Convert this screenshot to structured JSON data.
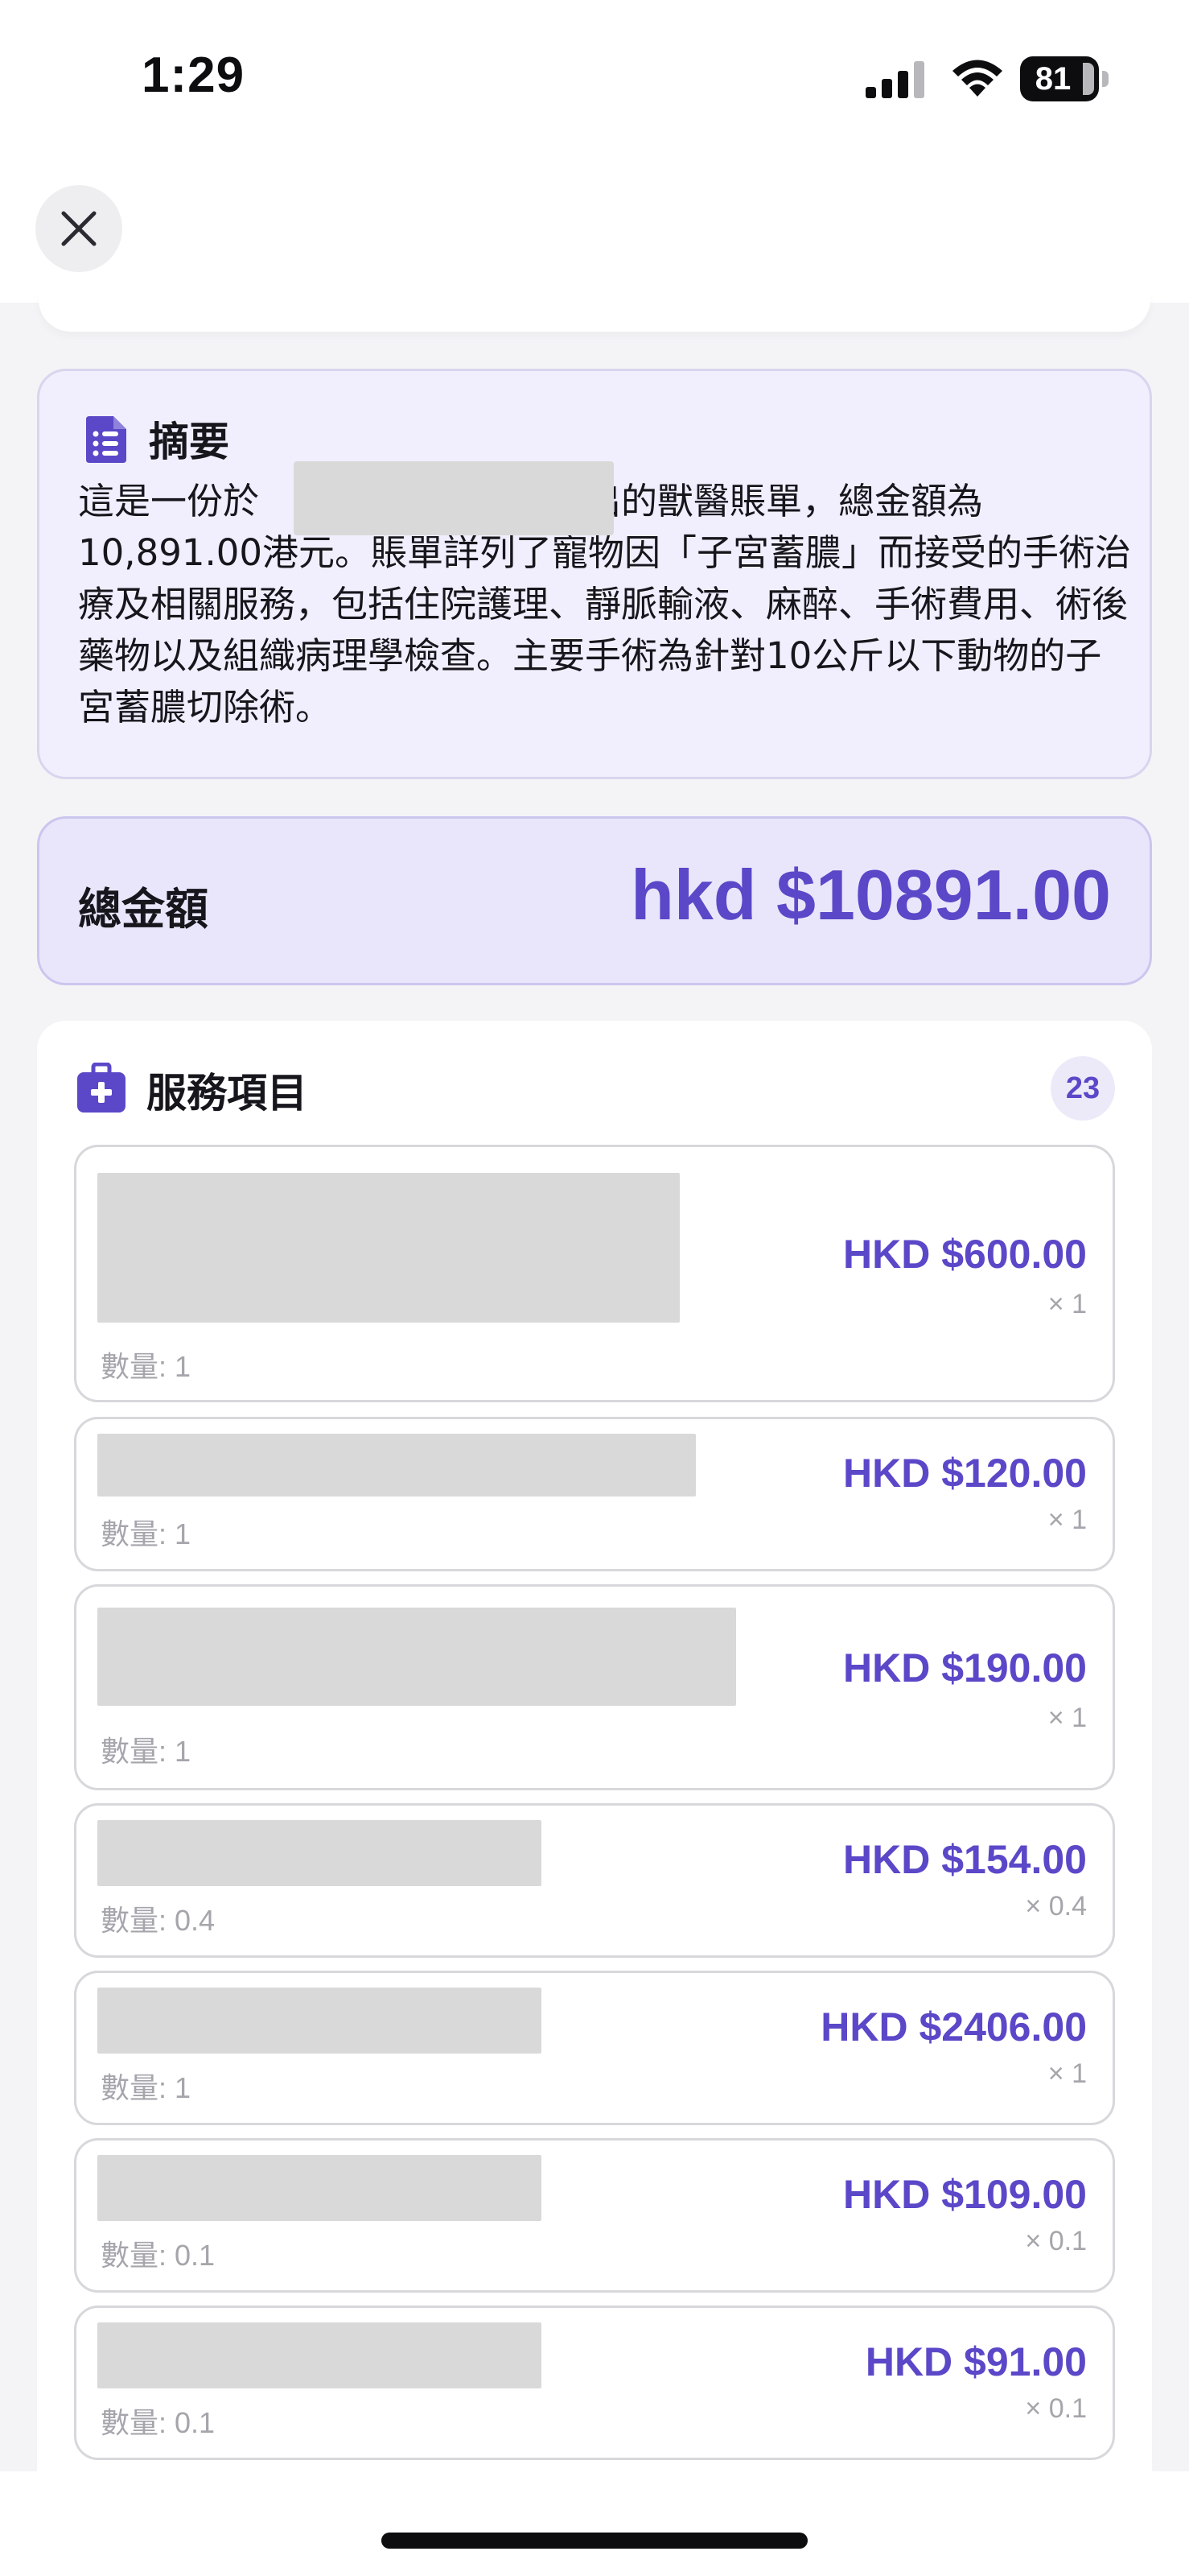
{
  "status_bar": {
    "time": "1:29",
    "battery": "81"
  },
  "header": {
    "close_icon": "close-icon"
  },
  "summary": {
    "icon": "document-icon",
    "title": "摘要",
    "text_part1": "這是一份於",
    "text_part2": "發出的獸醫賬單，總金額為10,891.00港元。賬單詳列了寵物因「子宮蓄膿」而接受的手術治療及相關服務，包括住院護理、靜脈輸液、麻醉、手術費用、術後藥物以及組織病理學檢查。主要手術為針對10公斤以下動物的子宮蓄膿切除術。"
  },
  "total": {
    "label": "總金額",
    "amount": "hkd $10891.00"
  },
  "services": {
    "icon": "medical-kit-icon",
    "title": "服務項目",
    "count": "23",
    "items": [
      {
        "qty_label": "數量: 1",
        "price": "HKD $600.00",
        "multiplier": "× 1"
      },
      {
        "qty_label": "數量: 1",
        "price": "HKD $120.00",
        "multiplier": "× 1"
      },
      {
        "qty_label": "數量: 1",
        "price": "HKD $190.00",
        "multiplier": "× 1"
      },
      {
        "qty_label": "數量: 0.4",
        "price": "HKD $154.00",
        "multiplier": "× 0.4"
      },
      {
        "qty_label": "數量: 1",
        "price": "HKD $2406.00",
        "multiplier": "× 1"
      },
      {
        "qty_label": "數量: 0.1",
        "price": "HKD $109.00",
        "multiplier": "× 0.1"
      },
      {
        "qty_label": "數量: 0.1",
        "price": "HKD $91.00",
        "multiplier": "× 0.1"
      }
    ]
  },
  "colors": {
    "accent": "#5a48c8",
    "summary_bg": "#f1effd",
    "total_bg": "#e9e6fb"
  }
}
